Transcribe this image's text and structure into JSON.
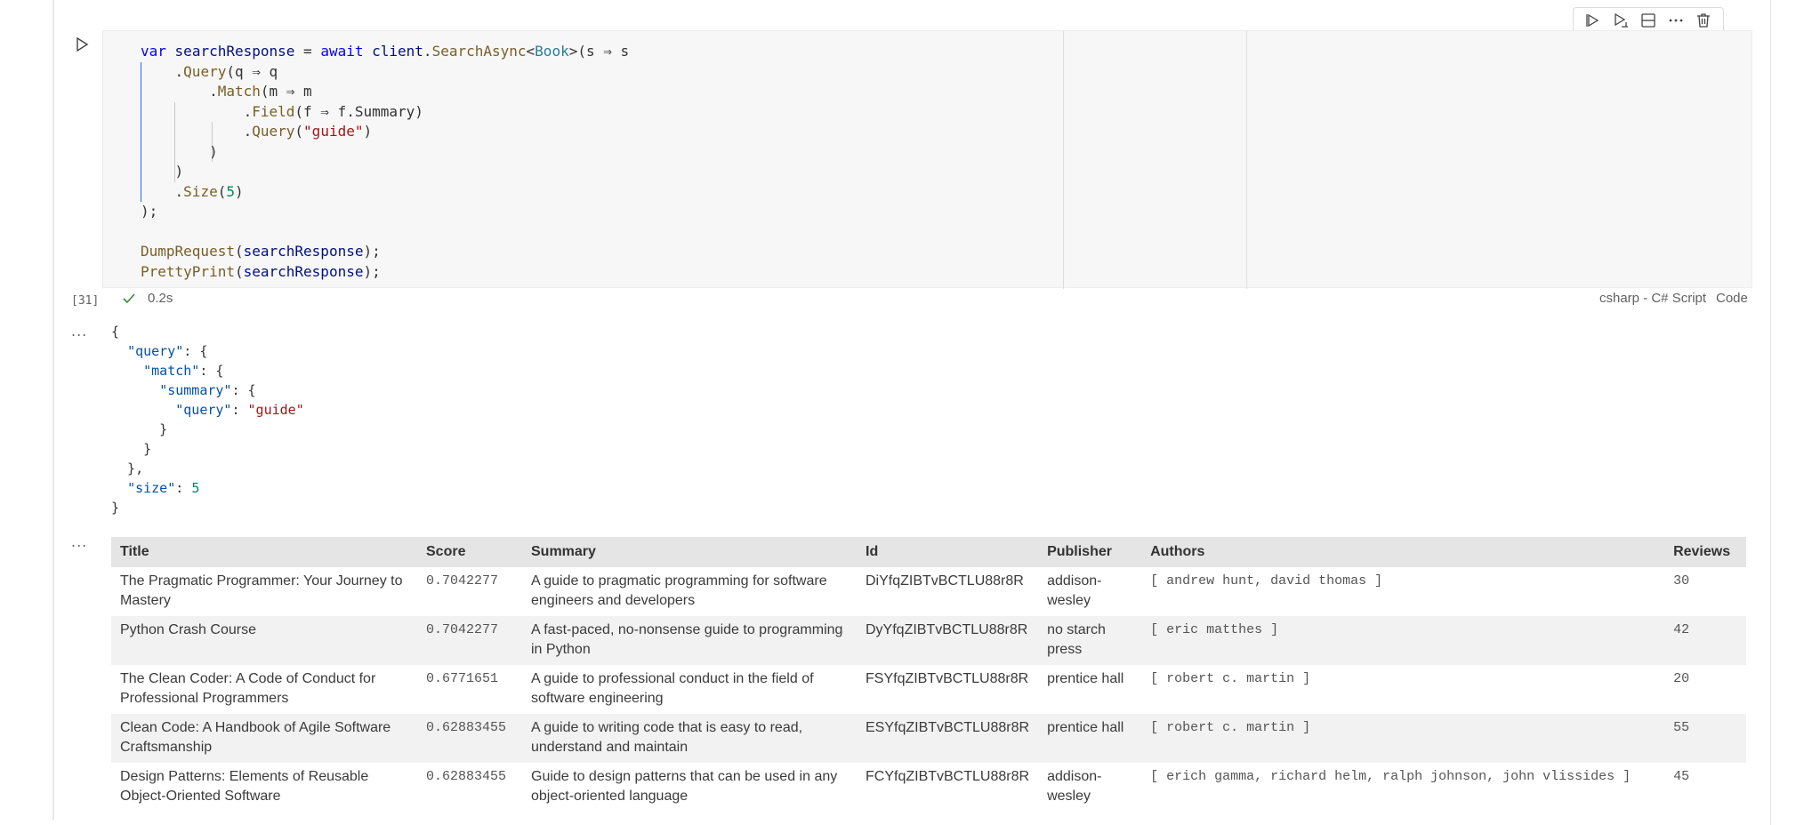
{
  "toolbar": {
    "buttons": [
      {
        "name": "execute-above-cells-button",
        "icon": "run-above-icon"
      },
      {
        "name": "execute-cell-and-below-button",
        "icon": "run-below-icon"
      },
      {
        "name": "split-cell-button",
        "icon": "split-icon"
      },
      {
        "name": "more-actions-button",
        "icon": "ellipsis-icon"
      },
      {
        "name": "delete-cell-button",
        "icon": "trash-icon"
      }
    ]
  },
  "cell": {
    "execution_count": "[31]",
    "exec_time": "0.2s",
    "language": "csharp - C# Script",
    "kind": "Code",
    "code_lines": [
      "var searchResponse = await client.SearchAsync<Book>(s => s",
      "    .Query(q => q",
      "        .Match(m => m",
      "            .Field(f => f.Summary)",
      "            .Query(\"guide\")",
      "        )",
      "    )",
      "    .Size(5)",
      ");",
      "",
      "DumpRequest(searchResponse);",
      "PrettyPrint(searchResponse);"
    ]
  },
  "output_more_label": "...",
  "json_output": [
    "{",
    "  \"query\": {",
    "    \"match\": {",
    "      \"summary\": {",
    "        \"query\": \"guide\"",
    "      }",
    "    }",
    "  },",
    "  \"size\": 5",
    "}"
  ],
  "table": {
    "columns": [
      "Title",
      "Score",
      "Summary",
      "Id",
      "Publisher",
      "Authors",
      "Reviews"
    ],
    "rows": [
      {
        "title": "The Pragmatic Programmer: Your Journey to Mastery",
        "score": "0.7042277",
        "summary": "A guide to pragmatic programming for software engineers and developers",
        "id": "DiYfqZIBTvBCTLU88r8R",
        "publisher": "addison-wesley",
        "authors": "[ andrew hunt, david thomas ]",
        "reviews": "30"
      },
      {
        "title": "Python Crash Course",
        "score": "0.7042277",
        "summary": "A fast-paced, no-nonsense guide to programming in Python",
        "id": "DyYfqZIBTvBCTLU88r8R",
        "publisher": "no starch press",
        "authors": "[ eric matthes ]",
        "reviews": "42"
      },
      {
        "title": "The Clean Coder: A Code of Conduct for Professional Programmers",
        "score": "0.6771651",
        "summary": "A guide to professional conduct in the field of software engineering",
        "id": "FSYfqZIBTvBCTLU88r8R",
        "publisher": "prentice hall",
        "authors": "[ robert c. martin ]",
        "reviews": "20"
      },
      {
        "title": "Clean Code: A Handbook of Agile Software Craftsmanship",
        "score": "0.62883455",
        "summary": "A guide to writing code that is easy to read, understand and maintain",
        "id": "ESYfqZIBTvBCTLU88r8R",
        "publisher": "prentice hall",
        "authors": "[ robert c. martin ]",
        "reviews": "55"
      },
      {
        "title": "Design Patterns: Elements of Reusable Object-Oriented Software",
        "score": "0.62883455",
        "summary": "Guide to design patterns that can be used in any object-oriented language",
        "id": "FCYfqZIBTvBCTLU88r8R",
        "publisher": "addison-wesley",
        "authors": "[ erich gamma, richard helm, ralph johnson, john vlissides ]",
        "reviews": "45"
      }
    ]
  },
  "colors": {
    "keyword": "#0000ff",
    "function": "#795e26",
    "type": "#267f99",
    "string": "#a31515",
    "number": "#098658",
    "json_key": "#0451a5",
    "success": "#388a34"
  }
}
